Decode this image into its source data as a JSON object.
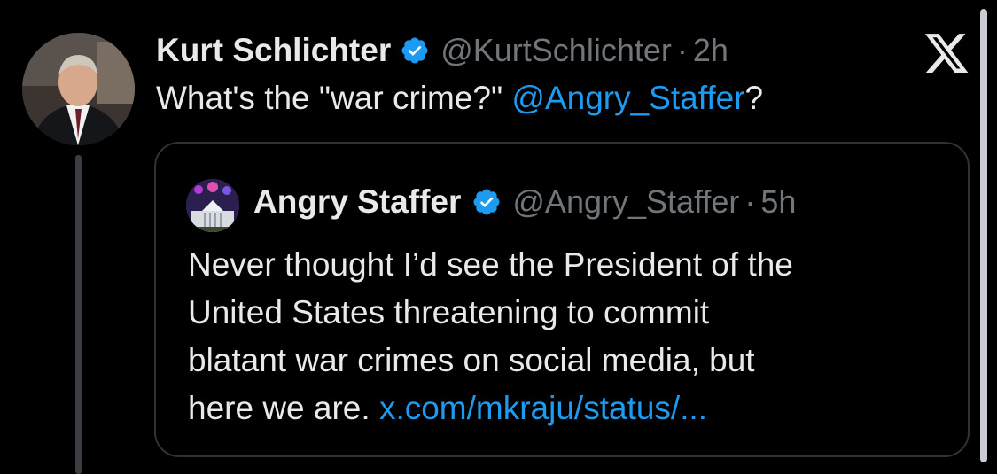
{
  "post": {
    "author_name": "Kurt Schlichter",
    "handle": "@KurtSchlichter",
    "separator": "·",
    "time": "2h",
    "text_prefix": "What's the \"war crime?\" ",
    "mention": "@Angry_Staffer",
    "text_suffix": "?"
  },
  "quote": {
    "author_name": "Angry Staffer",
    "handle": "@Angry_Staffer",
    "separator": "·",
    "time": "5h",
    "lines": [
      "Never thought I’d see the President of the",
      "United States threatening to commit",
      "blatant war crimes on social media, but"
    ],
    "last_line_text": "here we are. ",
    "link": "x.com/mkraju/status/..."
  },
  "icons": {
    "verified": "verified-badge-icon",
    "brand": "x-logo-icon"
  },
  "colors": {
    "background": "#000000",
    "text": "#e7e9ea",
    "secondary": "#71767b",
    "accent": "#1d9bf0",
    "border": "#2f3336"
  }
}
